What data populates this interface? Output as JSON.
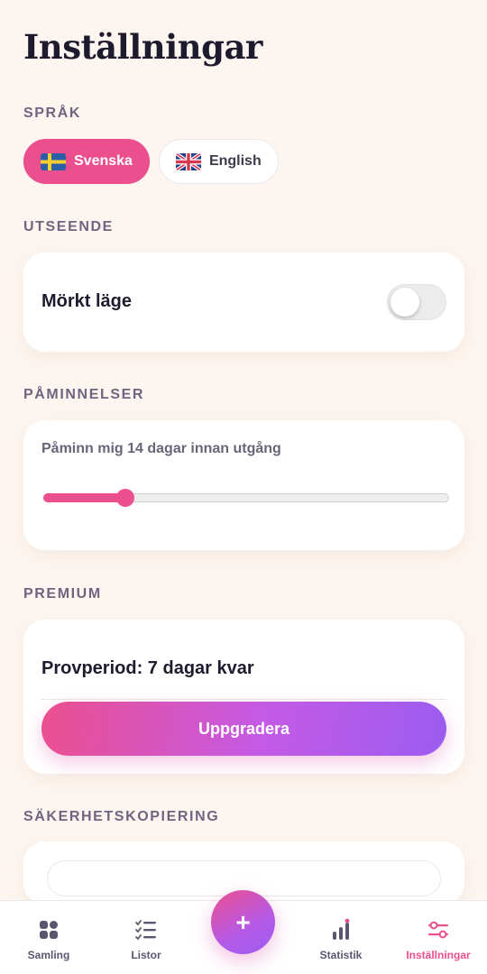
{
  "page": {
    "title": "Inställningar"
  },
  "language": {
    "label": "SPRÅK",
    "options": [
      {
        "label": "Svenska",
        "flag": "sweden-flag-icon",
        "selected": true
      },
      {
        "label": "English",
        "flag": "uk-flag-icon",
        "selected": false
      }
    ]
  },
  "appearance": {
    "label": "UTSEENDE",
    "dark_mode_label": "Mörkt läge",
    "dark_mode_on": false
  },
  "reminders": {
    "label": "PÅMINNELSER",
    "text": "Påminn mig 14 dagar innan utgång",
    "slider_fraction": 0.2
  },
  "premium": {
    "label": "PREMIUM",
    "trial_text": "Provperiod: 7 dagar kvar",
    "upgrade_label": "Uppgradera"
  },
  "backup": {
    "label": "SÄKERHETSKOPIERING"
  },
  "nav": {
    "items": [
      {
        "label": "Samling",
        "icon": "grid-icon",
        "active": false
      },
      {
        "label": "Listor",
        "icon": "checklist-icon",
        "active": false
      },
      {
        "label": "Statistik",
        "icon": "bar-chart-icon",
        "active": false
      },
      {
        "label": "Inställningar",
        "icon": "sliders-icon",
        "active": true
      }
    ],
    "fab_label": "+"
  },
  "colors": {
    "accent": "#ec4f8e",
    "accent_secondary": "#9b5cf0",
    "background": "#fdf5ef",
    "text": "#1f1b2e",
    "muted": "#6e6680"
  }
}
